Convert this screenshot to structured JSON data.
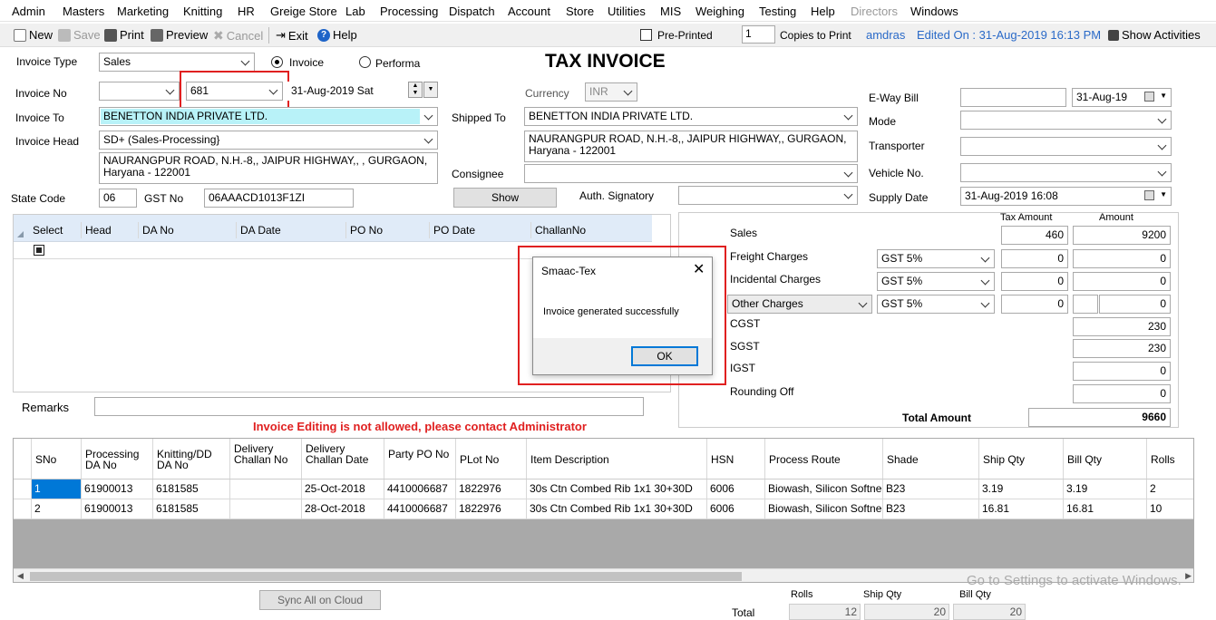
{
  "menu": [
    "Admin",
    "Masters",
    "Marketing",
    "Knitting",
    "HR",
    "Greige Store",
    "Lab",
    "Processing",
    "Dispatch",
    "Account",
    "Store",
    "Utilities",
    "MIS",
    "Weighing",
    "Testing",
    "Help",
    "Directors",
    "Windows"
  ],
  "toolbar": {
    "new": "New",
    "save": "Save",
    "print": "Print",
    "preview": "Preview",
    "cancel": "Cancel",
    "exit": "Exit",
    "help": "Help",
    "pre_printed": "Pre-Printed",
    "copies": "1",
    "copies_label": "Copies to Print",
    "user": "amdras",
    "edited_on": "Edited On : 31-Aug-2019 16:13 PM",
    "show_activities": "Show Activities"
  },
  "form": {
    "title": "TAX INVOICE",
    "invoice_type_label": "Invoice Type",
    "invoice_type": "Sales",
    "radio_invoice": "Invoice",
    "radio_performa": "Performa",
    "invoice_no_label": "Invoice No",
    "invoice_no": "681",
    "invoice_date": "31-Aug-2019  Sat",
    "invoice_to_label": "Invoice To",
    "invoice_to": "BENETTON INDIA PRIVATE LTD.",
    "invoice_head_label": "Invoice Head",
    "invoice_head": "SD+ (Sales-Processing}",
    "address": "NAURANGPUR ROAD, N.H.-8,, JAIPUR HIGHWAY,, , GURGAON, Haryana - 122001",
    "state_code_label": "State Code",
    "state_code": "06",
    "gst_no_label": "GST No",
    "gst_no": "06AAACD1013F1ZI",
    "currency_label": "Currency",
    "currency": "INR",
    "shipped_to_label": "Shipped To",
    "shipped_to": "BENETTON INDIA PRIVATE LTD.",
    "shipped_address": "NAURANGPUR ROAD, N.H.-8,, JAIPUR HIGHWAY,, GURGAON, Haryana - 122001",
    "consignee_label": "Consignee",
    "show_button": "Show",
    "auth_signatory_label": "Auth. Signatory",
    "eway_bill_label": "E-Way Bill",
    "eway_date": "31-Aug-19",
    "mode_label": "Mode",
    "transporter_label": "Transporter",
    "vehicle_label": "Vehicle No.",
    "supply_date_label": "Supply Date",
    "supply_date": "31-Aug-2019 16:08",
    "remarks_label": "Remarks",
    "warning": "Invoice Editing is not allowed, please contact Administrator"
  },
  "challan_grid": {
    "headers": [
      "Select",
      "Head",
      "DA No",
      "DA Date",
      "PO No",
      "PO Date",
      "ChallanNo"
    ]
  },
  "charges": {
    "tax_amount_header": "Tax Amount",
    "amount_header": "Amount",
    "sales_label": "Sales",
    "sales_tax": "460",
    "sales_amount": "9200",
    "freight_label": "Freight Charges",
    "freight_gst": "GST 5%",
    "freight_tax": "0",
    "freight_amount": "0",
    "incidental_label": "Incidental Charges",
    "incidental_gst": "GST 5%",
    "incidental_tax": "0",
    "incidental_amount": "0",
    "other_label": "Other Charges",
    "other_gst": "GST 5%",
    "other_tax": "0",
    "other_amount": "0",
    "cgst_label": "CGST",
    "cgst": "230",
    "sgst_label": "SGST",
    "sgst": "230",
    "igst_label": "IGST",
    "igst": "0",
    "rounding_label": "Rounding Off",
    "rounding": "0",
    "total_label": "Total Amount",
    "total": "9660"
  },
  "dialog": {
    "title": "Smaac-Tex",
    "message": "Invoice generated successfully",
    "ok": "OK"
  },
  "items": {
    "headers": [
      "SNo",
      "Processing DA No",
      "Knitting/DD DA No",
      "Delivery Challan No",
      "Delivery Challan Date",
      "Party PO No",
      "PLot No",
      "Item Description",
      "HSN",
      "Process Route",
      "Shade",
      "Ship Qty",
      "Bill Qty",
      "Rolls"
    ],
    "rows": [
      [
        "1",
        "61900013",
        "6181585",
        "",
        "25-Oct-2018",
        "4410006687",
        "1822976",
        "30s Ctn Combed Rib 1x1 30+30D",
        "6006",
        "Biowash, Silicon Softner...",
        "B23",
        "3.19",
        "3.19",
        "2"
      ],
      [
        "2",
        "61900013",
        "6181585",
        "",
        "28-Oct-2018",
        "4410006687",
        "1822976",
        "30s Ctn Combed Rib 1x1 30+30D",
        "6006",
        "Biowash, Silicon Softner...",
        "B23",
        "16.81",
        "16.81",
        "10"
      ]
    ]
  },
  "footer": {
    "sync": "Sync All on Cloud",
    "rolls_label": "Rolls",
    "ship_qty_label": "Ship Qty",
    "bill_qty_label": "Bill Qty",
    "total_label": "Total",
    "rolls": "12",
    "ship_qty": "20",
    "bill_qty": "20",
    "watermark": "Go to Settings to activate Windows."
  }
}
